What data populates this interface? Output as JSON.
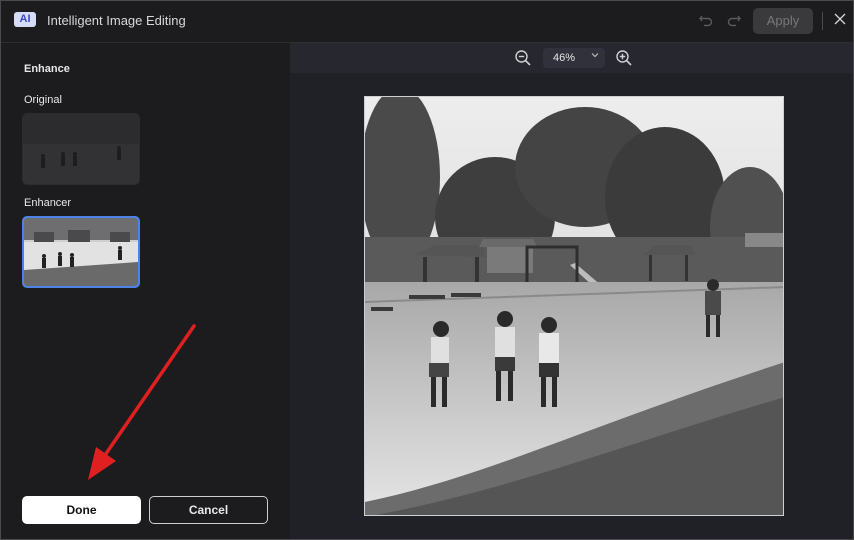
{
  "app": {
    "badge": "AI",
    "title": "Intelligent Image Editing",
    "apply_label": "Apply",
    "undo_icon": "undo-icon",
    "redo_icon": "redo-icon",
    "close_icon": "close-icon"
  },
  "left": {
    "section_title": "Enhance",
    "original_label": "Original",
    "enhancer_label": "Enhancer",
    "done_label": "Done",
    "cancel_label": "Cancel"
  },
  "zoom": {
    "value": "46%",
    "zoom_out_icon": "zoom-out-icon",
    "zoom_in_icon": "zoom-in-icon",
    "dropdown_icon": "chevron-down-icon"
  },
  "colors": {
    "accent": "#4d82e6",
    "arrow": "#e02020",
    "ai_badge_bg": "#d6dcf8",
    "ai_badge_text": "#3b48c8"
  }
}
